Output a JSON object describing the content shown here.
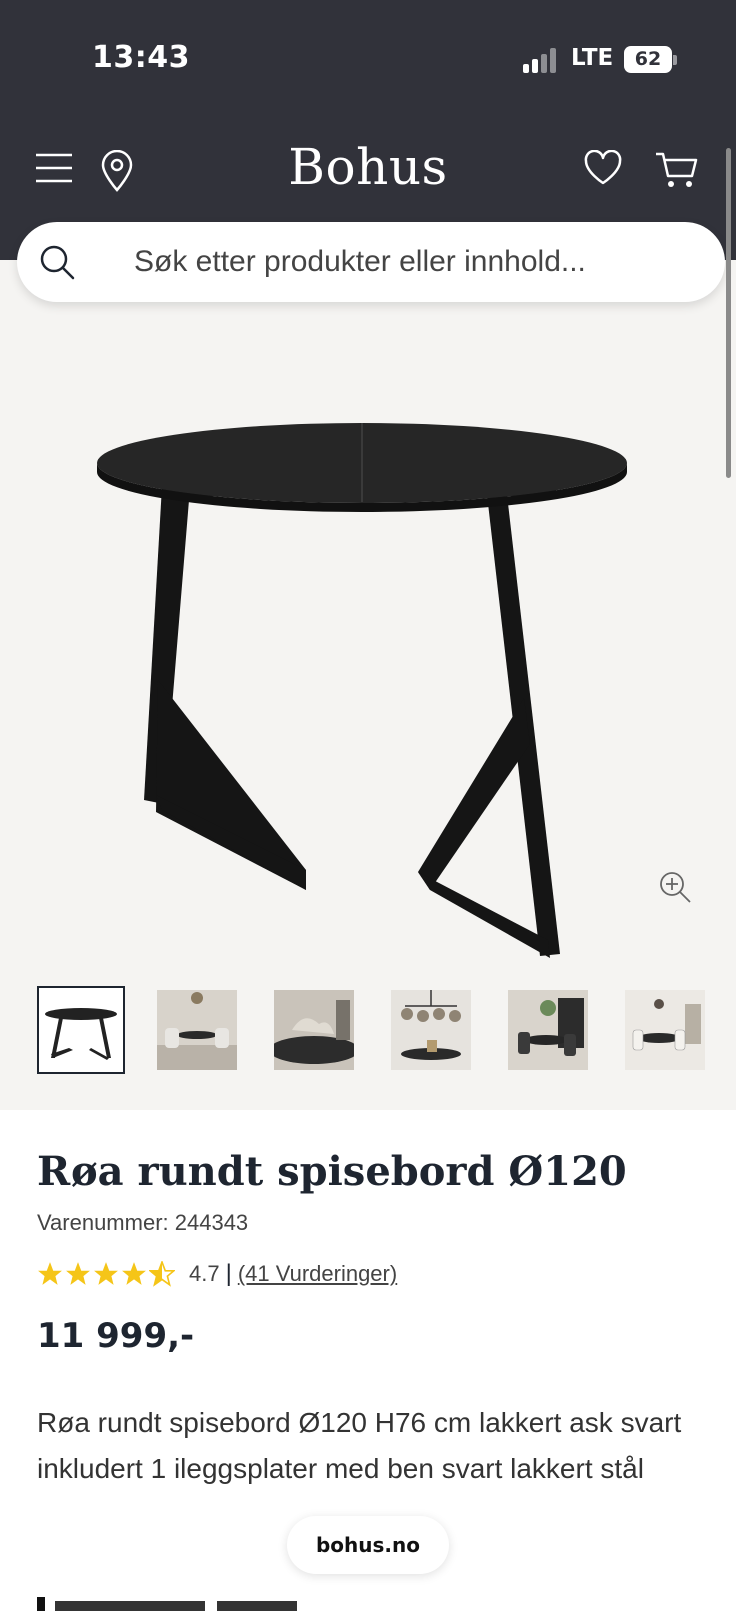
{
  "status_bar": {
    "time": "13:43",
    "network": "LTE",
    "battery": "62"
  },
  "header": {
    "logo": "Bohus",
    "icons": [
      "menu-icon",
      "location-icon",
      "heart-icon",
      "cart-icon"
    ]
  },
  "search": {
    "placeholder": "Søk etter produkter eller innhold..."
  },
  "gallery": {
    "thumbnail_count": 6,
    "active_index": 0
  },
  "product": {
    "title": "Røa rundt spisebord Ø120",
    "sku": "Varenummer: 244343",
    "rating_score": 4.7,
    "rating_score_label": "4.7",
    "rating_separator": "|",
    "rating_count": "(41 Vurderinger)",
    "price": "11 999,-",
    "description": "Røa rundt spisebord Ø120 H76 cm lakkert ask svart inkludert 1 ileggsplater med ben svart lakkert stål"
  },
  "browser": {
    "url": "bohus.no"
  },
  "colors": {
    "header_bg": "#31323a",
    "gallery_bg": "#f5f4f2",
    "star": "#f5c518",
    "text_dark": "#1e2530"
  }
}
